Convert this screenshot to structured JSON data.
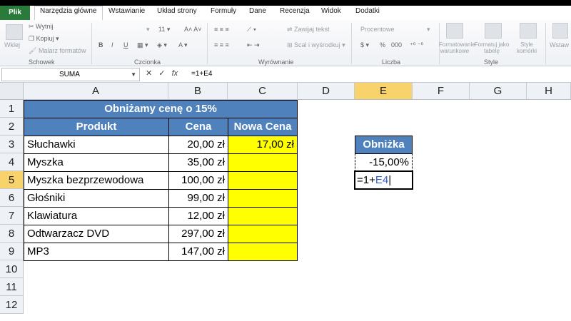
{
  "tabs": [
    "Plik",
    "Narzędzia główne",
    "Wstawianie",
    "Układ strony",
    "Formuły",
    "Dane",
    "Recenzja",
    "Widok",
    "Dodatki"
  ],
  "ribbon": {
    "clipboard": {
      "paste": "Wklej",
      "cut": "Wytnij",
      "copy": "Kopiuj",
      "format_painter": "Malarz formatów",
      "label": "Schowek"
    },
    "font": {
      "size": "11",
      "bold": "B",
      "italic": "I",
      "underline": "U",
      "label": "Czcionka"
    },
    "alignment": {
      "wrap": "Zawijaj tekst",
      "merge": "Scal i wyśrodkuj",
      "label": "Wyrównanie"
    },
    "number": {
      "format": "Procentowe",
      "percent": "%",
      "thousands": "000",
      "label": "Liczba"
    },
    "styles": {
      "conditional": "Formatowanie warunkowe",
      "as_table": "Formatuj jako tabelę",
      "cell_styles": "Style komórki",
      "label": "Style"
    },
    "cells": {
      "insert": "Wstaw"
    }
  },
  "formula_bar": {
    "name_box": "SUMA",
    "fx": "fx",
    "formula": "=1+E4"
  },
  "columns": [
    "A",
    "B",
    "C",
    "D",
    "E",
    "F",
    "G",
    "H"
  ],
  "rows": [
    "1",
    "2",
    "3",
    "4",
    "5",
    "6",
    "7",
    "8",
    "9",
    "10",
    "11",
    "12"
  ],
  "sheet": {
    "title": "Obniżamy cenę o 15%",
    "headers": {
      "product": "Produkt",
      "price": "Cena",
      "new_price": "Nowa Cena"
    },
    "items": [
      {
        "product": "Słuchawki",
        "price": "20,00 zł",
        "new_price": "17,00 zł"
      },
      {
        "product": "Myszka",
        "price": "35,00 zł",
        "new_price": ""
      },
      {
        "product": "Myszka bezprzewodowa",
        "price": "100,00 zł",
        "new_price": ""
      },
      {
        "product": "Głośniki",
        "price": "99,00 zł",
        "new_price": ""
      },
      {
        "product": "Klawiatura",
        "price": "12,00 zł",
        "new_price": ""
      },
      {
        "product": "Odtwarzacz DVD",
        "price": "297,00 zł",
        "new_price": ""
      },
      {
        "product": "MP3",
        "price": "147,00 zł",
        "new_price": ""
      }
    ],
    "discount_label": "Obniżka",
    "discount_value": "-15,00%",
    "editing_prefix": "=1+",
    "editing_ref": "E4"
  }
}
